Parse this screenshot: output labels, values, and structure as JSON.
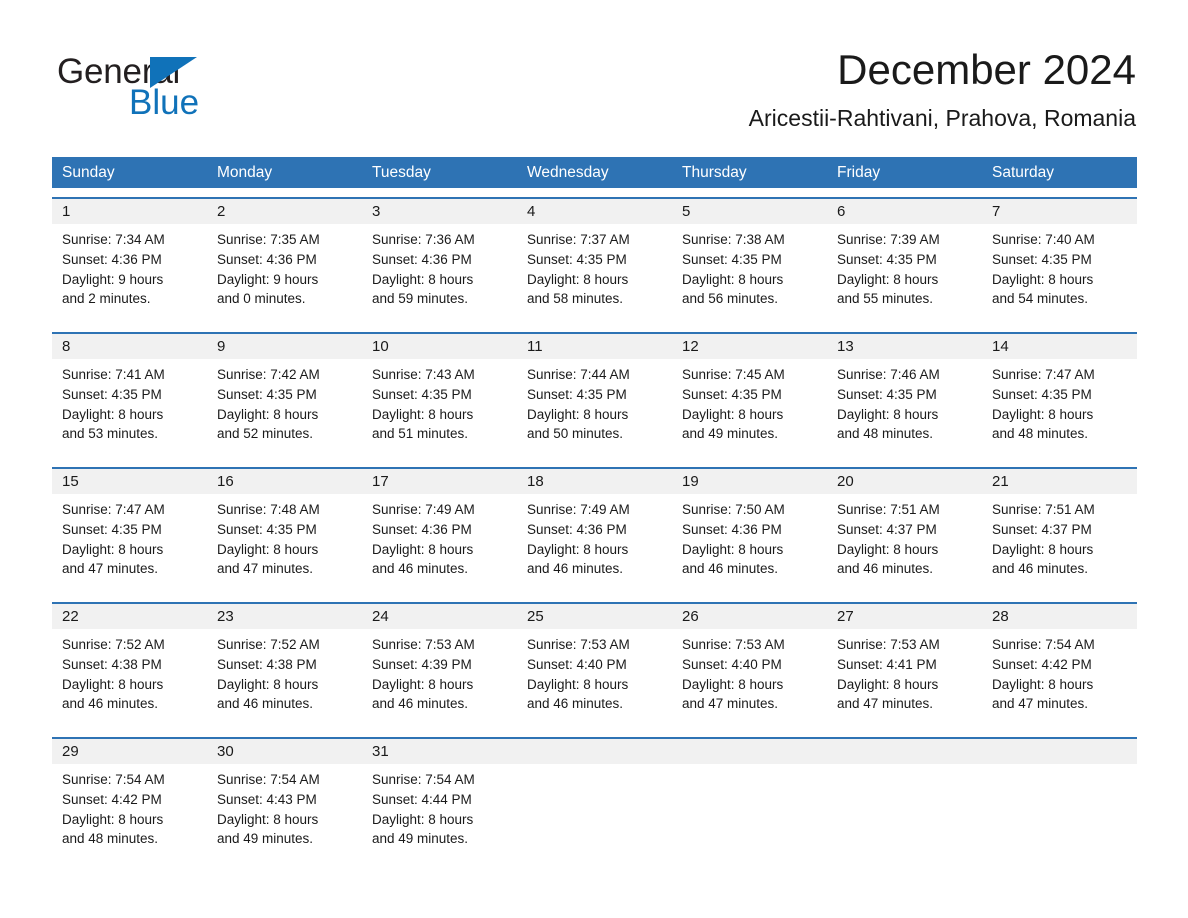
{
  "brand": {
    "name_part1": "General",
    "name_part2": "Blue",
    "accent_color": "#1072b9",
    "triangle_icon": "triangle-icon"
  },
  "header": {
    "title": "December 2024",
    "subtitle": "Aricestii-Rahtivani, Prahova, Romania"
  },
  "calendar": {
    "header_bg": "#2e73b4",
    "daynum_bg": "#f1f1f1",
    "weekdays": [
      "Sunday",
      "Monday",
      "Tuesday",
      "Wednesday",
      "Thursday",
      "Friday",
      "Saturday"
    ],
    "weeks": [
      {
        "days": [
          {
            "num": "1",
            "sunrise": "Sunrise: 7:34 AM",
            "sunset": "Sunset: 4:36 PM",
            "daylight_line1": "Daylight: 9 hours",
            "daylight_line2": "and 2 minutes."
          },
          {
            "num": "2",
            "sunrise": "Sunrise: 7:35 AM",
            "sunset": "Sunset: 4:36 PM",
            "daylight_line1": "Daylight: 9 hours",
            "daylight_line2": "and 0 minutes."
          },
          {
            "num": "3",
            "sunrise": "Sunrise: 7:36 AM",
            "sunset": "Sunset: 4:36 PM",
            "daylight_line1": "Daylight: 8 hours",
            "daylight_line2": "and 59 minutes."
          },
          {
            "num": "4",
            "sunrise": "Sunrise: 7:37 AM",
            "sunset": "Sunset: 4:35 PM",
            "daylight_line1": "Daylight: 8 hours",
            "daylight_line2": "and 58 minutes."
          },
          {
            "num": "5",
            "sunrise": "Sunrise: 7:38 AM",
            "sunset": "Sunset: 4:35 PM",
            "daylight_line1": "Daylight: 8 hours",
            "daylight_line2": "and 56 minutes."
          },
          {
            "num": "6",
            "sunrise": "Sunrise: 7:39 AM",
            "sunset": "Sunset: 4:35 PM",
            "daylight_line1": "Daylight: 8 hours",
            "daylight_line2": "and 55 minutes."
          },
          {
            "num": "7",
            "sunrise": "Sunrise: 7:40 AM",
            "sunset": "Sunset: 4:35 PM",
            "daylight_line1": "Daylight: 8 hours",
            "daylight_line2": "and 54 minutes."
          }
        ]
      },
      {
        "days": [
          {
            "num": "8",
            "sunrise": "Sunrise: 7:41 AM",
            "sunset": "Sunset: 4:35 PM",
            "daylight_line1": "Daylight: 8 hours",
            "daylight_line2": "and 53 minutes."
          },
          {
            "num": "9",
            "sunrise": "Sunrise: 7:42 AM",
            "sunset": "Sunset: 4:35 PM",
            "daylight_line1": "Daylight: 8 hours",
            "daylight_line2": "and 52 minutes."
          },
          {
            "num": "10",
            "sunrise": "Sunrise: 7:43 AM",
            "sunset": "Sunset: 4:35 PM",
            "daylight_line1": "Daylight: 8 hours",
            "daylight_line2": "and 51 minutes."
          },
          {
            "num": "11",
            "sunrise": "Sunrise: 7:44 AM",
            "sunset": "Sunset: 4:35 PM",
            "daylight_line1": "Daylight: 8 hours",
            "daylight_line2": "and 50 minutes."
          },
          {
            "num": "12",
            "sunrise": "Sunrise: 7:45 AM",
            "sunset": "Sunset: 4:35 PM",
            "daylight_line1": "Daylight: 8 hours",
            "daylight_line2": "and 49 minutes."
          },
          {
            "num": "13",
            "sunrise": "Sunrise: 7:46 AM",
            "sunset": "Sunset: 4:35 PM",
            "daylight_line1": "Daylight: 8 hours",
            "daylight_line2": "and 48 minutes."
          },
          {
            "num": "14",
            "sunrise": "Sunrise: 7:47 AM",
            "sunset": "Sunset: 4:35 PM",
            "daylight_line1": "Daylight: 8 hours",
            "daylight_line2": "and 48 minutes."
          }
        ]
      },
      {
        "days": [
          {
            "num": "15",
            "sunrise": "Sunrise: 7:47 AM",
            "sunset": "Sunset: 4:35 PM",
            "daylight_line1": "Daylight: 8 hours",
            "daylight_line2": "and 47 minutes."
          },
          {
            "num": "16",
            "sunrise": "Sunrise: 7:48 AM",
            "sunset": "Sunset: 4:35 PM",
            "daylight_line1": "Daylight: 8 hours",
            "daylight_line2": "and 47 minutes."
          },
          {
            "num": "17",
            "sunrise": "Sunrise: 7:49 AM",
            "sunset": "Sunset: 4:36 PM",
            "daylight_line1": "Daylight: 8 hours",
            "daylight_line2": "and 46 minutes."
          },
          {
            "num": "18",
            "sunrise": "Sunrise: 7:49 AM",
            "sunset": "Sunset: 4:36 PM",
            "daylight_line1": "Daylight: 8 hours",
            "daylight_line2": "and 46 minutes."
          },
          {
            "num": "19",
            "sunrise": "Sunrise: 7:50 AM",
            "sunset": "Sunset: 4:36 PM",
            "daylight_line1": "Daylight: 8 hours",
            "daylight_line2": "and 46 minutes."
          },
          {
            "num": "20",
            "sunrise": "Sunrise: 7:51 AM",
            "sunset": "Sunset: 4:37 PM",
            "daylight_line1": "Daylight: 8 hours",
            "daylight_line2": "and 46 minutes."
          },
          {
            "num": "21",
            "sunrise": "Sunrise: 7:51 AM",
            "sunset": "Sunset: 4:37 PM",
            "daylight_line1": "Daylight: 8 hours",
            "daylight_line2": "and 46 minutes."
          }
        ]
      },
      {
        "days": [
          {
            "num": "22",
            "sunrise": "Sunrise: 7:52 AM",
            "sunset": "Sunset: 4:38 PM",
            "daylight_line1": "Daylight: 8 hours",
            "daylight_line2": "and 46 minutes."
          },
          {
            "num": "23",
            "sunrise": "Sunrise: 7:52 AM",
            "sunset": "Sunset: 4:38 PM",
            "daylight_line1": "Daylight: 8 hours",
            "daylight_line2": "and 46 minutes."
          },
          {
            "num": "24",
            "sunrise": "Sunrise: 7:53 AM",
            "sunset": "Sunset: 4:39 PM",
            "daylight_line1": "Daylight: 8 hours",
            "daylight_line2": "and 46 minutes."
          },
          {
            "num": "25",
            "sunrise": "Sunrise: 7:53 AM",
            "sunset": "Sunset: 4:40 PM",
            "daylight_line1": "Daylight: 8 hours",
            "daylight_line2": "and 46 minutes."
          },
          {
            "num": "26",
            "sunrise": "Sunrise: 7:53 AM",
            "sunset": "Sunset: 4:40 PM",
            "daylight_line1": "Daylight: 8 hours",
            "daylight_line2": "and 47 minutes."
          },
          {
            "num": "27",
            "sunrise": "Sunrise: 7:53 AM",
            "sunset": "Sunset: 4:41 PM",
            "daylight_line1": "Daylight: 8 hours",
            "daylight_line2": "and 47 minutes."
          },
          {
            "num": "28",
            "sunrise": "Sunrise: 7:54 AM",
            "sunset": "Sunset: 4:42 PM",
            "daylight_line1": "Daylight: 8 hours",
            "daylight_line2": "and 47 minutes."
          }
        ]
      },
      {
        "days": [
          {
            "num": "29",
            "sunrise": "Sunrise: 7:54 AM",
            "sunset": "Sunset: 4:42 PM",
            "daylight_line1": "Daylight: 8 hours",
            "daylight_line2": "and 48 minutes."
          },
          {
            "num": "30",
            "sunrise": "Sunrise: 7:54 AM",
            "sunset": "Sunset: 4:43 PM",
            "daylight_line1": "Daylight: 8 hours",
            "daylight_line2": "and 49 minutes."
          },
          {
            "num": "31",
            "sunrise": "Sunrise: 7:54 AM",
            "sunset": "Sunset: 4:44 PM",
            "daylight_line1": "Daylight: 8 hours",
            "daylight_line2": "and 49 minutes."
          },
          {
            "num": "",
            "sunrise": "",
            "sunset": "",
            "daylight_line1": "",
            "daylight_line2": ""
          },
          {
            "num": "",
            "sunrise": "",
            "sunset": "",
            "daylight_line1": "",
            "daylight_line2": ""
          },
          {
            "num": "",
            "sunrise": "",
            "sunset": "",
            "daylight_line1": "",
            "daylight_line2": ""
          },
          {
            "num": "",
            "sunrise": "",
            "sunset": "",
            "daylight_line1": "",
            "daylight_line2": ""
          }
        ]
      }
    ]
  }
}
